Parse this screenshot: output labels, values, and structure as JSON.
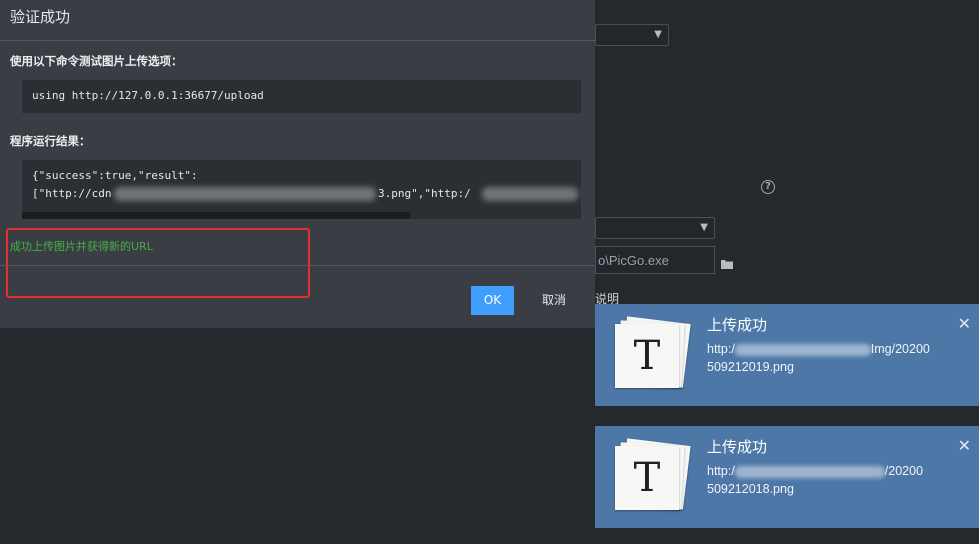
{
  "dialog": {
    "title": "验证成功",
    "cmd_label": "使用以下命令测试图片上传选项：",
    "cmd": "using http://127.0.0.1:36677/upload",
    "result_label": "程序运行结果：",
    "result_line1": "{\"success\":true,\"result\":",
    "result_line2_a": "[\"http://cdn",
    "result_line2_b": "3.png\",\"http:/",
    "success_text": "成功上传图片并获得新的URL",
    "ok_label": "OK",
    "cancel_label": "取消"
  },
  "background": {
    "path_value": "o\\PicGo.exe",
    "help_glyph": "?",
    "link_fragment": "说明",
    "caret": "▼"
  },
  "toasts": [
    {
      "title": "上传成功",
      "url_start": "http:/",
      "url_mid_end": "Img/20200",
      "url_line2": "509212019.png",
      "logo_letter": "T",
      "close": "✕"
    },
    {
      "title": "上传成功",
      "url_start": "http:/",
      "url_mid_end": "/20200",
      "url_line2": "509212018.png",
      "logo_letter": "T",
      "close": "✕"
    }
  ],
  "colors": {
    "ok_button": "#409eff",
    "success_text": "#43b046",
    "highlight_border": "#e53030",
    "toast_bg": "#4d77a7"
  }
}
